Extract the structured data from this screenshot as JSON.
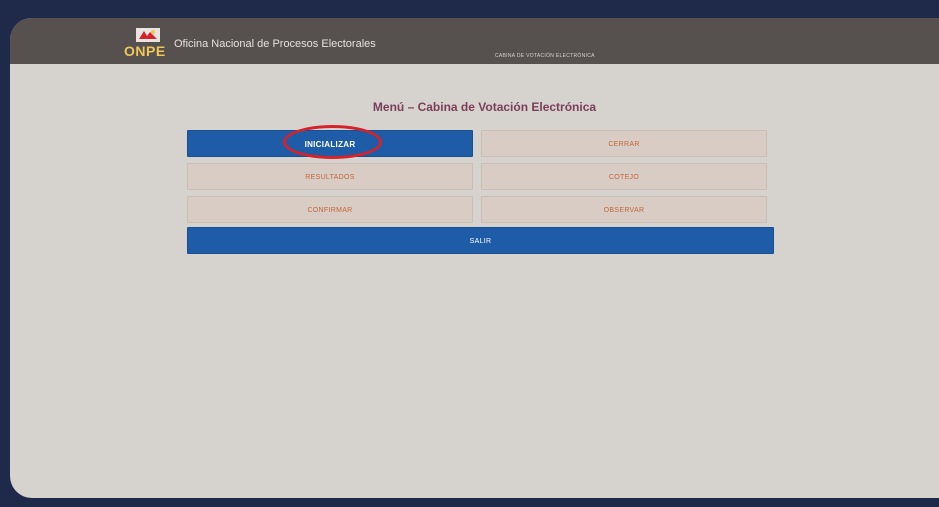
{
  "header": {
    "logo_text": "ONPE",
    "org_name": "Oficina Nacional de Procesos Electorales",
    "subtitle": "CABINA DE VOTACIÓN ELECTRÓNICA"
  },
  "menu": {
    "title": "Menú – Cabina de Votación Electrónica",
    "buttons": {
      "inicializar": "INICIALIZAR",
      "cerrar": "CERRAR",
      "resultados": "RESULTADOS",
      "cotejo": "COTEJO",
      "confirmar": "CONFIRMAR",
      "observar": "OBSERVAR",
      "salir": "SALIR"
    }
  },
  "colors": {
    "header_bg": "#56514f",
    "page_bg": "#d6d3cf",
    "primary_button": "#1f5ca8",
    "secondary_button": "#d9ccc4",
    "secondary_text": "#c0673a",
    "title_text": "#7a3d5a",
    "highlight": "#d4232a"
  },
  "icons": {
    "logo": "onpe-logo-icon"
  }
}
